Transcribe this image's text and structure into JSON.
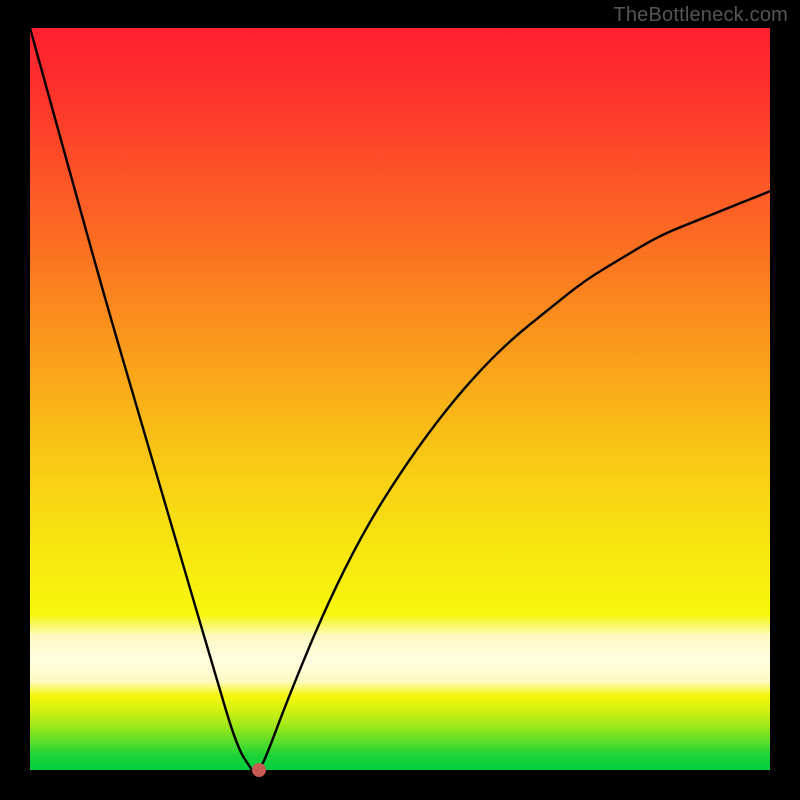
{
  "watermark": "TheBottleneck.com",
  "chart_data": {
    "type": "line",
    "title": "",
    "xlabel": "",
    "ylabel": "",
    "xlim": [
      0,
      100
    ],
    "ylim": [
      0,
      100
    ],
    "grid": false,
    "legend": false,
    "series": [
      {
        "name": "bottleneck-curve",
        "x": [
          0,
          5,
          10,
          15,
          20,
          25,
          28,
          30,
          31,
          32,
          35,
          40,
          45,
          50,
          55,
          60,
          65,
          70,
          75,
          80,
          85,
          90,
          95,
          100
        ],
        "values": [
          100,
          82,
          64,
          47,
          30,
          13,
          3,
          0,
          0,
          2,
          10,
          22,
          32,
          40,
          47,
          53,
          58,
          62,
          66,
          69,
          72,
          74,
          76,
          78
        ]
      }
    ],
    "annotations": [
      {
        "name": "optimal-marker",
        "x": 31,
        "y": 0,
        "color": "#c75a52"
      }
    ],
    "background_gradient": {
      "orientation": "vertical",
      "stops": [
        {
          "pos": 0.0,
          "color": "#fe2130"
        },
        {
          "pos": 0.5,
          "color": "#f9b317"
        },
        {
          "pos": 0.79,
          "color": "#f7f70c"
        },
        {
          "pos": 0.85,
          "color": "#fffde0"
        },
        {
          "pos": 1.0,
          "color": "#00cf40"
        }
      ]
    }
  }
}
